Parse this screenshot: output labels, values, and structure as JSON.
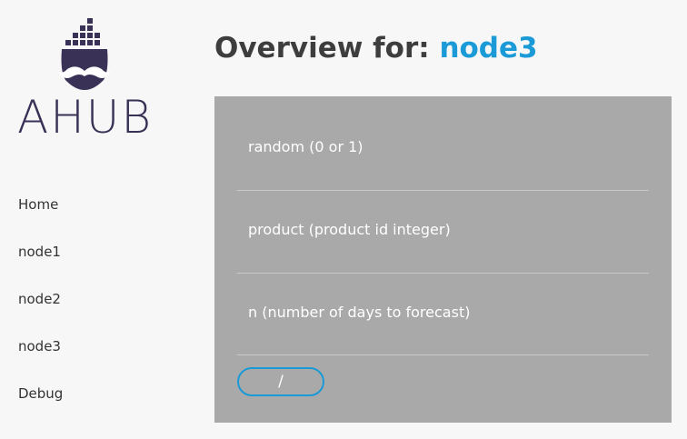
{
  "brand": {
    "name": "AHUB"
  },
  "nav": {
    "items": [
      {
        "label": "Home"
      },
      {
        "label": "node1"
      },
      {
        "label": "node2"
      },
      {
        "label": "node3"
      },
      {
        "label": "Debug"
      }
    ]
  },
  "header": {
    "prefix": "Overview for:",
    "node": "node3"
  },
  "form": {
    "fields": [
      {
        "label": "random (0 or 1)"
      },
      {
        "label": "product (product id integer)"
      },
      {
        "label": "n (number of days to forecast)"
      }
    ],
    "submit_label": "/"
  },
  "colors": {
    "accent": "#1a9ad6",
    "logo": "#3a3256",
    "panel": "#a9a9a9",
    "background": "#f7f7f7"
  }
}
